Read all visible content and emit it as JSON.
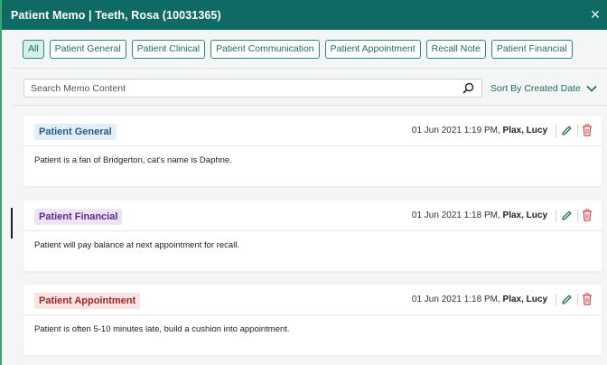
{
  "window": {
    "title": "Patient Memo | Teeth, Rosa (10031365)",
    "close_symbol": "×"
  },
  "filters": [
    {
      "label": "All",
      "active": true
    },
    {
      "label": "Patient General",
      "active": false
    },
    {
      "label": "Patient Clinical",
      "active": false
    },
    {
      "label": "Patient Communication",
      "active": false
    },
    {
      "label": "Patient Appointment",
      "active": false
    },
    {
      "label": "Recall Note",
      "active": false
    },
    {
      "label": "Patient Financial",
      "active": false
    }
  ],
  "search": {
    "placeholder": "Search Memo Content",
    "value": ""
  },
  "sort": {
    "label": "Sort By Created Date"
  },
  "memos": [
    {
      "category": "Patient General",
      "category_color": "#1f5e8c",
      "category_bg": "#e3eef8",
      "timestamp": "01 Jun 2021 1:19 PM,",
      "author": "Plax, Lucy",
      "content": "Patient is a fan of Bridgerton, cat's name is Daphne."
    },
    {
      "category": "Patient Financial",
      "category_color": "#5b2c8f",
      "category_bg": "#efe4f6",
      "timestamp": "01 Jun 2021 1:18 PM,",
      "author": "Plax, Lucy",
      "content": "Patient will pay balance at next appointment for recall."
    },
    {
      "category": "Patient Appointment",
      "category_color": "#a3262c",
      "category_bg": "#fae3e3",
      "timestamp": "01 Jun 2021 1:18 PM,",
      "author": "Plax, Lucy",
      "content": "Patient is often 5-10 minutes late, build a cushion into appointment."
    }
  ],
  "colors": {
    "header": "#0f6a63",
    "accent": "#1f6c64",
    "delete": "#d0464a",
    "edit": "#1f6c64"
  },
  "icons": {
    "close": "close-icon",
    "search": "search-icon",
    "sort": "chevron-down-icon",
    "edit": "pencil-icon",
    "delete": "trash-icon"
  }
}
